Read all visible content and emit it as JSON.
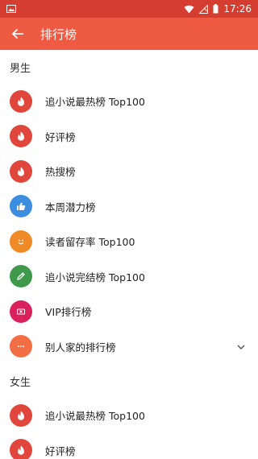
{
  "status_bar": {
    "time": "17:26"
  },
  "app_bar": {
    "title": "排行榜"
  },
  "colors": {
    "status_bar": "#d43d2f",
    "app_bar": "#ef5a43",
    "red": "#e0463b",
    "blue": "#3e8ee0",
    "orange": "#f08a26",
    "green": "#3e9a4a",
    "magenta": "#d9225d",
    "coral": "#f36d45"
  },
  "sections": [
    {
      "title": "男生",
      "items": [
        {
          "label": "追小说最热榜 Top100",
          "icon": "flame-icon",
          "color": "#e0463b"
        },
        {
          "label": "好评榜",
          "icon": "flame-icon",
          "color": "#e0463b"
        },
        {
          "label": "热搜榜",
          "icon": "flame-icon",
          "color": "#e0463b"
        },
        {
          "label": "本周潜力榜",
          "icon": "thumbs-up-icon",
          "color": "#3e8ee0"
        },
        {
          "label": "读者留存率 Top100",
          "icon": "smiley-icon",
          "color": "#f08a26"
        },
        {
          "label": "追小说完结榜 Top100",
          "icon": "pencil-icon",
          "color": "#3e9a4a"
        },
        {
          "label": "VIP排行榜",
          "icon": "ticket-icon",
          "color": "#d9225d"
        },
        {
          "label": "别人家的排行榜",
          "icon": "more-dots-icon",
          "color": "#f36d45",
          "expandable": true
        }
      ]
    },
    {
      "title": "女生",
      "items": [
        {
          "label": "追小说最热榜 Top100",
          "icon": "flame-icon",
          "color": "#e0463b"
        },
        {
          "label": "好评榜",
          "icon": "flame-icon",
          "color": "#e0463b"
        }
      ]
    }
  ]
}
